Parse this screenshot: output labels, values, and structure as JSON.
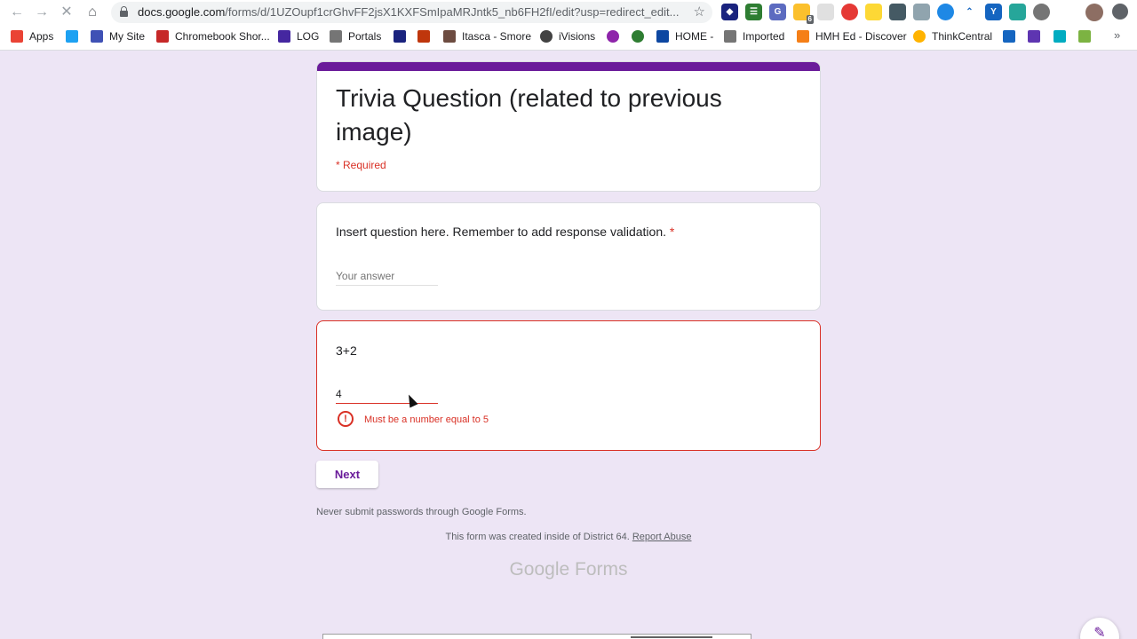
{
  "browser": {
    "url_host": "docs.google.com",
    "url_path": "/forms/d/1UZOupf1crGhvFF2jsX1KXFSmIpaMRJntk5_nb6FH2fI/edit?usp=redirect_edit...",
    "extension_badge": "6"
  },
  "bookmarks": [
    {
      "label": "Apps",
      "color": "#ea4335"
    },
    {
      "label": "",
      "color": "#1da1f2"
    },
    {
      "label": "My Site",
      "color": "#3f51b5"
    },
    {
      "label": "Chromebook Shor...",
      "color": "#c62828"
    },
    {
      "label": "LOG",
      "color": "#4527a0"
    },
    {
      "label": "Portals",
      "color": "#757575"
    },
    {
      "label": "",
      "color": "#1a237e"
    },
    {
      "label": "",
      "color": "#bf360c"
    },
    {
      "label": "Itasca - Smore",
      "color": "#6d4c41"
    },
    {
      "label": "iVisions",
      "color": "#424242"
    },
    {
      "label": "",
      "color": "#8e24aa"
    },
    {
      "label": "",
      "color": "#2e7d32"
    },
    {
      "label": "HOME -",
      "color": "#0d47a1"
    },
    {
      "label": "Imported",
      "color": "#757575"
    },
    {
      "label": "HMH Ed - Discover",
      "color": "#f57f17"
    },
    {
      "label": "ThinkCentral",
      "color": "#ffb300"
    },
    {
      "label": "",
      "color": "#1565c0"
    },
    {
      "label": "",
      "color": "#5e35b1"
    },
    {
      "label": "",
      "color": "#00acc1"
    },
    {
      "label": "",
      "color": "#7cb342"
    }
  ],
  "form": {
    "title": "Trivia Question (related to previous image)",
    "required_note": "* Required",
    "accent_color": "#6a1b9a",
    "question1": {
      "text": "Insert question here. Remember to add response validation.",
      "required_mark": "*",
      "placeholder": "Your answer"
    },
    "question2": {
      "text": "3+2",
      "value": "4",
      "error": "Must be a number equal to 5"
    },
    "next_label": "Next",
    "password_warning": "Never submit passwords through Google Forms.",
    "created_note": "This form was created inside of District 64.",
    "report_abuse": "Report Abuse",
    "brand": "Google Forms"
  }
}
